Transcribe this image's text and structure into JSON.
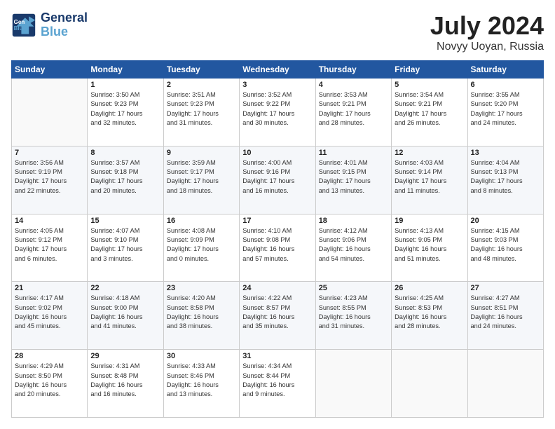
{
  "header": {
    "logo_line1": "General",
    "logo_line2": "Blue",
    "month": "July 2024",
    "location": "Novyy Uoyan, Russia"
  },
  "weekdays": [
    "Sunday",
    "Monday",
    "Tuesday",
    "Wednesday",
    "Thursday",
    "Friday",
    "Saturday"
  ],
  "weeks": [
    [
      {
        "day": "",
        "info": ""
      },
      {
        "day": "1",
        "info": "Sunrise: 3:50 AM\nSunset: 9:23 PM\nDaylight: 17 hours\nand 32 minutes."
      },
      {
        "day": "2",
        "info": "Sunrise: 3:51 AM\nSunset: 9:23 PM\nDaylight: 17 hours\nand 31 minutes."
      },
      {
        "day": "3",
        "info": "Sunrise: 3:52 AM\nSunset: 9:22 PM\nDaylight: 17 hours\nand 30 minutes."
      },
      {
        "day": "4",
        "info": "Sunrise: 3:53 AM\nSunset: 9:21 PM\nDaylight: 17 hours\nand 28 minutes."
      },
      {
        "day": "5",
        "info": "Sunrise: 3:54 AM\nSunset: 9:21 PM\nDaylight: 17 hours\nand 26 minutes."
      },
      {
        "day": "6",
        "info": "Sunrise: 3:55 AM\nSunset: 9:20 PM\nDaylight: 17 hours\nand 24 minutes."
      }
    ],
    [
      {
        "day": "7",
        "info": "Sunrise: 3:56 AM\nSunset: 9:19 PM\nDaylight: 17 hours\nand 22 minutes."
      },
      {
        "day": "8",
        "info": "Sunrise: 3:57 AM\nSunset: 9:18 PM\nDaylight: 17 hours\nand 20 minutes."
      },
      {
        "day": "9",
        "info": "Sunrise: 3:59 AM\nSunset: 9:17 PM\nDaylight: 17 hours\nand 18 minutes."
      },
      {
        "day": "10",
        "info": "Sunrise: 4:00 AM\nSunset: 9:16 PM\nDaylight: 17 hours\nand 16 minutes."
      },
      {
        "day": "11",
        "info": "Sunrise: 4:01 AM\nSunset: 9:15 PM\nDaylight: 17 hours\nand 13 minutes."
      },
      {
        "day": "12",
        "info": "Sunrise: 4:03 AM\nSunset: 9:14 PM\nDaylight: 17 hours\nand 11 minutes."
      },
      {
        "day": "13",
        "info": "Sunrise: 4:04 AM\nSunset: 9:13 PM\nDaylight: 17 hours\nand 8 minutes."
      }
    ],
    [
      {
        "day": "14",
        "info": "Sunrise: 4:05 AM\nSunset: 9:12 PM\nDaylight: 17 hours\nand 6 minutes."
      },
      {
        "day": "15",
        "info": "Sunrise: 4:07 AM\nSunset: 9:10 PM\nDaylight: 17 hours\nand 3 minutes."
      },
      {
        "day": "16",
        "info": "Sunrise: 4:08 AM\nSunset: 9:09 PM\nDaylight: 17 hours\nand 0 minutes."
      },
      {
        "day": "17",
        "info": "Sunrise: 4:10 AM\nSunset: 9:08 PM\nDaylight: 16 hours\nand 57 minutes."
      },
      {
        "day": "18",
        "info": "Sunrise: 4:12 AM\nSunset: 9:06 PM\nDaylight: 16 hours\nand 54 minutes."
      },
      {
        "day": "19",
        "info": "Sunrise: 4:13 AM\nSunset: 9:05 PM\nDaylight: 16 hours\nand 51 minutes."
      },
      {
        "day": "20",
        "info": "Sunrise: 4:15 AM\nSunset: 9:03 PM\nDaylight: 16 hours\nand 48 minutes."
      }
    ],
    [
      {
        "day": "21",
        "info": "Sunrise: 4:17 AM\nSunset: 9:02 PM\nDaylight: 16 hours\nand 45 minutes."
      },
      {
        "day": "22",
        "info": "Sunrise: 4:18 AM\nSunset: 9:00 PM\nDaylight: 16 hours\nand 41 minutes."
      },
      {
        "day": "23",
        "info": "Sunrise: 4:20 AM\nSunset: 8:58 PM\nDaylight: 16 hours\nand 38 minutes."
      },
      {
        "day": "24",
        "info": "Sunrise: 4:22 AM\nSunset: 8:57 PM\nDaylight: 16 hours\nand 35 minutes."
      },
      {
        "day": "25",
        "info": "Sunrise: 4:23 AM\nSunset: 8:55 PM\nDaylight: 16 hours\nand 31 minutes."
      },
      {
        "day": "26",
        "info": "Sunrise: 4:25 AM\nSunset: 8:53 PM\nDaylight: 16 hours\nand 28 minutes."
      },
      {
        "day": "27",
        "info": "Sunrise: 4:27 AM\nSunset: 8:51 PM\nDaylight: 16 hours\nand 24 minutes."
      }
    ],
    [
      {
        "day": "28",
        "info": "Sunrise: 4:29 AM\nSunset: 8:50 PM\nDaylight: 16 hours\nand 20 minutes."
      },
      {
        "day": "29",
        "info": "Sunrise: 4:31 AM\nSunset: 8:48 PM\nDaylight: 16 hours\nand 16 minutes."
      },
      {
        "day": "30",
        "info": "Sunrise: 4:33 AM\nSunset: 8:46 PM\nDaylight: 16 hours\nand 13 minutes."
      },
      {
        "day": "31",
        "info": "Sunrise: 4:34 AM\nSunset: 8:44 PM\nDaylight: 16 hours\nand 9 minutes."
      },
      {
        "day": "",
        "info": ""
      },
      {
        "day": "",
        "info": ""
      },
      {
        "day": "",
        "info": ""
      }
    ]
  ]
}
